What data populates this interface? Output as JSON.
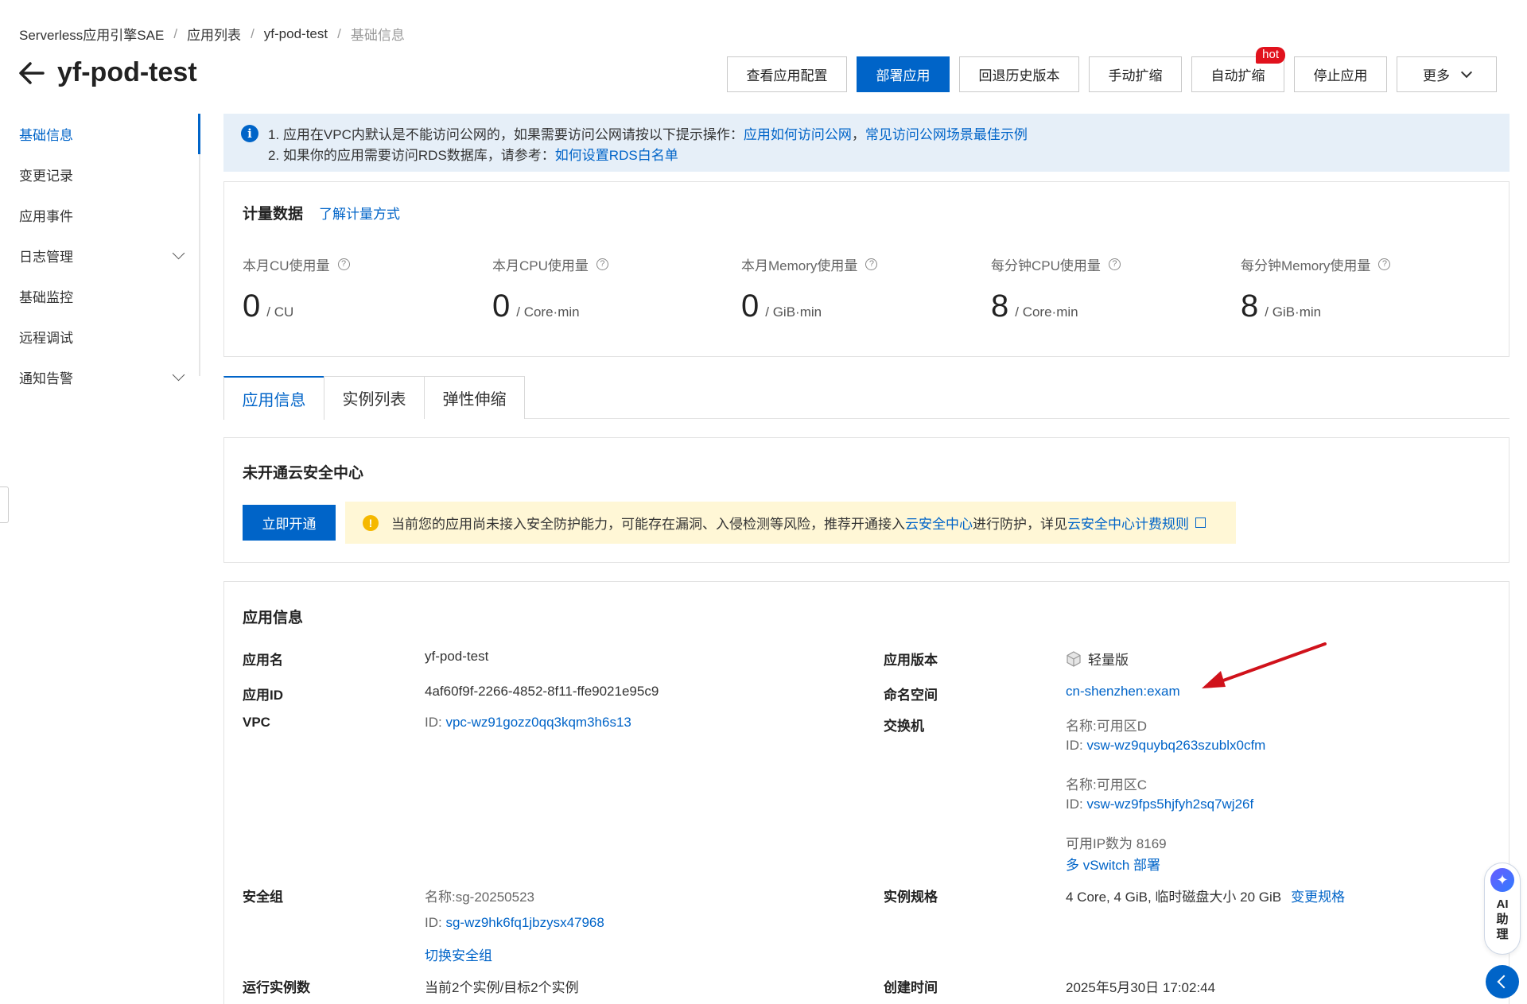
{
  "breadcrumb": [
    "Serverless应用引擎SAE",
    "应用列表",
    "yf-pod-test",
    "基础信息"
  ],
  "page_title": "yf-pod-test",
  "actions": {
    "view_config": "查看应用配置",
    "deploy": "部署应用",
    "rollback": "回退历史版本",
    "manual_scale": "手动扩缩",
    "auto_scale": "自动扩缩",
    "hot_badge": "hot",
    "stop": "停止应用",
    "more": "更多"
  },
  "sidebar": {
    "items": [
      {
        "label": "基础信息"
      },
      {
        "label": "变更记录"
      },
      {
        "label": "应用事件"
      },
      {
        "label": "日志管理"
      },
      {
        "label": "基础监控"
      },
      {
        "label": "远程调试"
      },
      {
        "label": "通知告警"
      }
    ]
  },
  "banner": {
    "line1_text": "1. 应用在VPC内默认是不能访问公网的，如果需要访问公网请按以下提示操作：",
    "line1_link1": "应用如何访问公网",
    "line1_comma": "，",
    "line1_link2": "常见访问公网场景最佳示例",
    "line2_text": "2. 如果你的应用需要访问RDS数据库，请参考：",
    "line2_link": "如何设置RDS白名单"
  },
  "metering": {
    "title": "计量数据",
    "link": "了解计量方式",
    "metrics": [
      {
        "label": "本月CU使用量",
        "value": "0",
        "unit": "/ CU"
      },
      {
        "label": "本月CPU使用量",
        "value": "0",
        "unit": "/ Core·min"
      },
      {
        "label": "本月Memory使用量",
        "value": "0",
        "unit": "/ GiB·min"
      },
      {
        "label": "每分钟CPU使用量",
        "value": "8",
        "unit": "/ Core·min"
      },
      {
        "label": "每分钟Memory使用量",
        "value": "8",
        "unit": "/ GiB·min"
      }
    ]
  },
  "tabs": [
    "应用信息",
    "实例列表",
    "弹性伸缩"
  ],
  "security": {
    "title": "未开通云安全中心",
    "button": "立即开通",
    "warn_text": "当前您的应用尚未接入安全防护能力，可能存在漏洞、入侵检测等风险，推荐开通接入",
    "warn_link1": "云安全中心",
    "warn_mid": "进行防护，详见 ",
    "warn_link2": "云安全中心计费规则"
  },
  "app_info": {
    "title": "应用信息",
    "app_name_label": "应用名",
    "app_name": "yf-pod-test",
    "app_id_label": "应用ID",
    "app_id": "4af60f9f-2266-4852-8f11-ffe9021e95c9",
    "vpc_label": "VPC",
    "vpc_prefix": "ID: ",
    "vpc_id": "vpc-wz91gozz0qq3kqm3h6s13",
    "version_label": "应用版本",
    "version": "轻量版",
    "namespace_label": "命名空间",
    "namespace": "cn-shenzhen:exam",
    "vswitch_label": "交换机",
    "vswitch1_name": "名称:可用区D",
    "vswitch1_prefix": "ID: ",
    "vswitch1_id": "vsw-wz9quybq263szublx0cfm",
    "vswitch2_name": "名称:可用区C",
    "vswitch2_prefix": "ID: ",
    "vswitch2_id": "vsw-wz9fps5hjfyh2sq7wj26f",
    "available_ip": "可用IP数为 8169",
    "multi_vswitch": "多 vSwitch 部署",
    "sg_label": "安全组",
    "sg_name": "名称:sg-20250523",
    "sg_prefix": "ID: ",
    "sg_id": "sg-wz9hk6fq1jbzysx47968",
    "sg_switch": "切换安全组",
    "spec_label": "实例规格",
    "spec": "4 Core, 4 GiB, 临时磁盘大小 20 GiB",
    "spec_change": "变更规格",
    "instances_label": "运行实例数",
    "instances": "当前2个实例/目标2个实例",
    "created_label": "创建时间",
    "created": "2025年5月30日 17:02:44"
  },
  "ai_assistant": "AI助理",
  "colors": {
    "primary": "#0064c8",
    "hot": "#e1121d",
    "annotation_arrow": "#d0121b",
    "warning_bg": "#fff7d6",
    "info_bg": "#e6eff8"
  }
}
